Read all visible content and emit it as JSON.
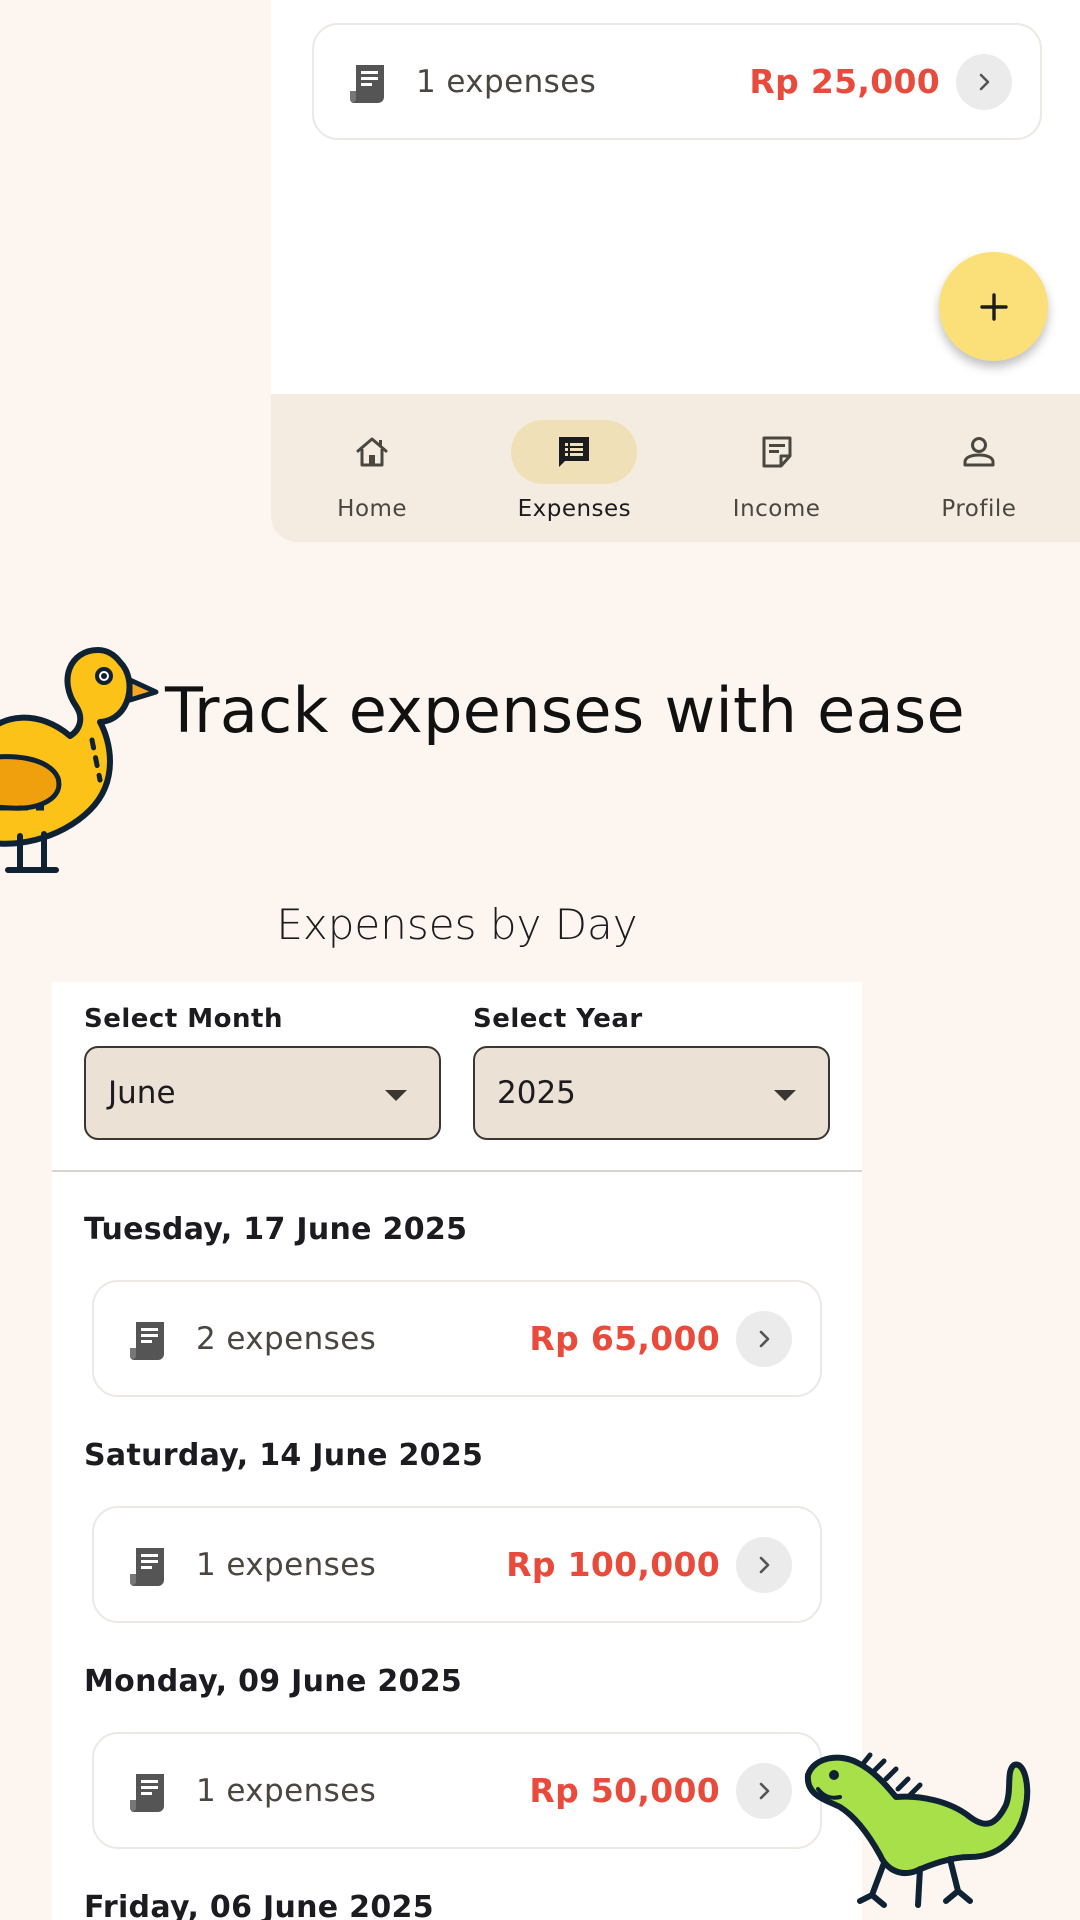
{
  "top_card": {
    "count": "1 expenses",
    "amount": "Rp 25,000"
  },
  "fab": {
    "icon": "plus-icon"
  },
  "bottom_nav": {
    "items": [
      {
        "label": "Home",
        "icon": "home-icon",
        "active": false
      },
      {
        "label": "Expenses",
        "icon": "expenses-icon",
        "active": true
      },
      {
        "label": "Income",
        "icon": "income-icon",
        "active": false
      },
      {
        "label": "Profile",
        "icon": "profile-icon",
        "active": false
      }
    ]
  },
  "headline": "Track expenses with ease",
  "section_title": "Expenses by Day",
  "filters": {
    "month_label": "Select Month",
    "month_value": "June",
    "year_label": "Select Year",
    "year_value": "2025"
  },
  "days": [
    {
      "date": "Tuesday, 17 June 2025",
      "count": "2 expenses",
      "amount": "Rp 65,000"
    },
    {
      "date": "Saturday, 14 June 2025",
      "count": "1 expenses",
      "amount": "Rp 100,000"
    },
    {
      "date": "Monday, 09 June 2025",
      "count": "1 expenses",
      "amount": "Rp 50,000"
    },
    {
      "date": "Friday, 06 June 2025"
    }
  ],
  "colors": {
    "accent_amount": "#e84b3c",
    "fab": "#fbe07a",
    "nav_active": "#f0e0b8",
    "background": "#fdf6f0"
  }
}
